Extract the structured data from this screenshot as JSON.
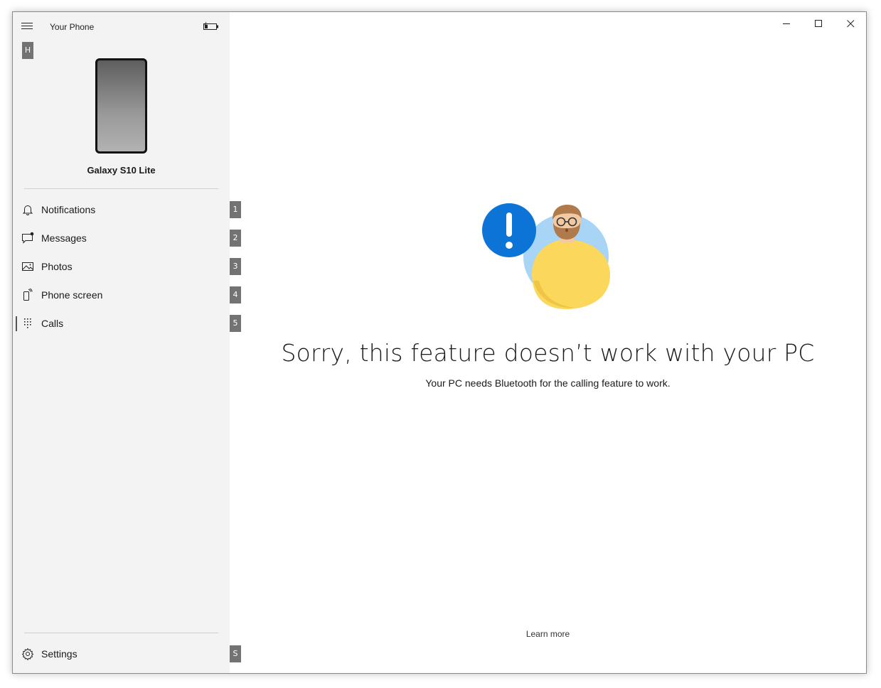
{
  "app": {
    "title": "Your Phone"
  },
  "sidebar": {
    "device_name": "Galaxy S10 Lite",
    "header_key": "H",
    "items": [
      {
        "label": "Notifications",
        "key": "1",
        "icon": "bell-icon"
      },
      {
        "label": "Messages",
        "key": "2",
        "icon": "message-icon"
      },
      {
        "label": "Photos",
        "key": "3",
        "icon": "photo-icon"
      },
      {
        "label": "Phone screen",
        "key": "4",
        "icon": "phone-screen-icon"
      },
      {
        "label": "Calls",
        "key": "5",
        "icon": "dialpad-icon",
        "active": true
      }
    ],
    "settings": {
      "label": "Settings",
      "key": "S",
      "icon": "gear-icon"
    }
  },
  "main": {
    "headline": "Sorry, this feature doesn’t work with your PC",
    "message": "Your PC needs Bluetooth for the calling feature to work.",
    "learn_more": "Learn more"
  },
  "colors": {
    "sidebar_bg": "#f3f3f3",
    "accent_blue": "#0b74d6",
    "illustration_yellow": "#fbd75b",
    "illustration_light_blue": "#a8d4f5",
    "key_badge": "#737373"
  }
}
